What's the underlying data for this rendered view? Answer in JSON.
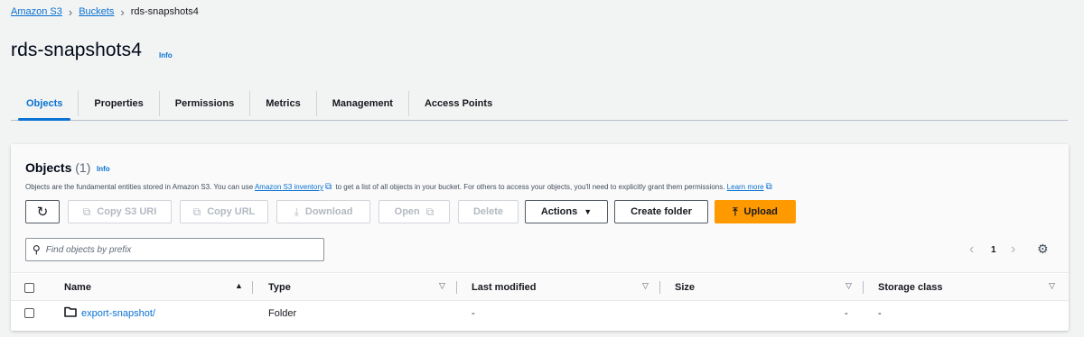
{
  "breadcrumb": {
    "items": [
      "Amazon S3",
      "Buckets"
    ],
    "current": "rds-snapshots4"
  },
  "page": {
    "title": "rds-snapshots4",
    "info": "Info"
  },
  "tabs": [
    "Objects",
    "Properties",
    "Permissions",
    "Metrics",
    "Management",
    "Access Points"
  ],
  "objects_panel": {
    "title": "Objects",
    "count": "(1)",
    "info": "Info",
    "description": {
      "before": "Objects are the fundamental entities stored in Amazon S3. You can use",
      "link1": "Amazon S3 inventory",
      "middle": "to get a list of all objects in your bucket. For others to access your objects, you'll need to explicitly grant them permissions.",
      "link2": "Learn more"
    },
    "buttons": {
      "refresh_icon": "refresh-icon",
      "copy_s3_uri": "Copy S3 URI",
      "copy_url": "Copy URL",
      "download": "Download",
      "open": "Open",
      "delete": "Delete",
      "actions": "Actions",
      "create_folder": "Create folder",
      "upload": "Upload"
    },
    "search": {
      "placeholder": "Find objects by prefix",
      "value": ""
    },
    "pagination": {
      "current_page": "1"
    },
    "table": {
      "columns": [
        "Name",
        "Type",
        "Last modified",
        "Size",
        "Storage class"
      ],
      "rows": [
        {
          "name": "export-snapshot/",
          "type": "Folder",
          "last_modified": "-",
          "size": "-",
          "storage_class": "-"
        }
      ]
    }
  },
  "colors": {
    "link": "#0972d3",
    "primary_button": "#ff9900",
    "background": "#f2f3f3"
  }
}
